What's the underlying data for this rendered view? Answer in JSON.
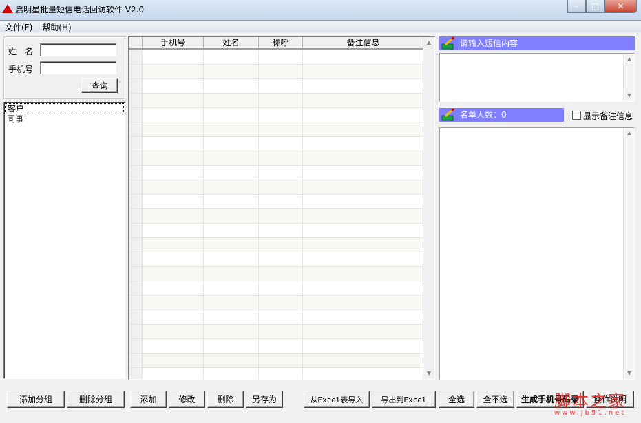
{
  "window": {
    "title": "启明星批量短信电话回访软件 V2.0"
  },
  "menu": [
    "文件(F)",
    "帮助(H)"
  ],
  "search": {
    "name_label": "姓　名",
    "phone_label": "手机号",
    "name_value": "",
    "phone_value": "",
    "query_button": "查询"
  },
  "groups": {
    "items": [
      "客户",
      "同事"
    ],
    "selected": 0
  },
  "grid": {
    "columns": [
      "手机号",
      "姓名",
      "称呼",
      "备注信息"
    ],
    "rows": []
  },
  "sms": {
    "banner": "请输入短信内容",
    "content": ""
  },
  "recipients": {
    "banner": "名单人数：0",
    "show_notes_label": "显示备注信息",
    "show_notes_checked": false
  },
  "buttons": {
    "add_group": "添加分组",
    "delete_group": "删除分组",
    "add": "添加",
    "edit": "修改",
    "delete": "删除",
    "save_as": "另存为",
    "import_excel": "从Excel表导入",
    "export_excel": "导出到Excel",
    "select_all": "全选",
    "select_none": "全不选",
    "generate": "生成手机号码录",
    "help": "操作说明"
  },
  "watermark": {
    "line1": "脚本之家",
    "line2": "www.jb51.net"
  },
  "colors": {
    "banner": "#8080ff",
    "close": "#c7422f"
  }
}
